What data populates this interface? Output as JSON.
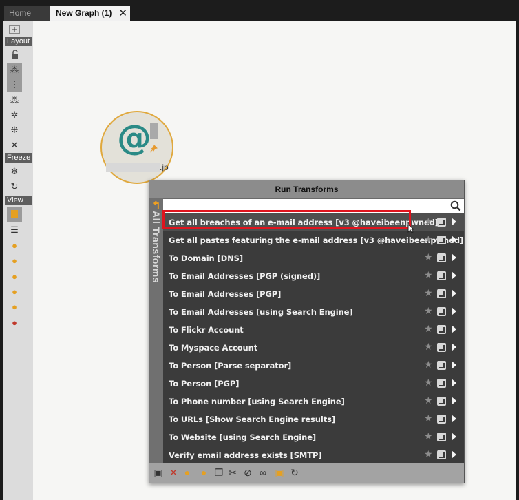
{
  "tabs": {
    "home": "Home",
    "active": "New Graph (1)",
    "close_glyph": "✕"
  },
  "toolbar": {
    "layout_label": "Layout",
    "freeze_label": "Freeze",
    "view_label": "View"
  },
  "entity": {
    "glyph": "@",
    "label_suffix": ".jp",
    "pin_icon": "pin-icon"
  },
  "panel": {
    "title": "Run Transforms",
    "side_label": "All Transforms",
    "search_value": "",
    "transforms": [
      "Get all breaches of an e-mail address [v3 @haveibeenpwned]",
      "Get all pastes featuring the e-mail address [v3 @haveibeenpwned]",
      "To Domain [DNS]",
      "To Email Addresses [PGP (signed)]",
      "To Email Addresses [PGP]",
      "To Email Addresses [using Search Engine]",
      "To Flickr Account",
      "To Myspace Account",
      "To Person [Parse separator]",
      "To Person [PGP]",
      "To Phone number [using Search Engine]",
      "To URLs [Show Search Engine results]",
      "To Website [using Search Engine]",
      "Verify email address exists [SMTP]"
    ]
  },
  "colors": {
    "accent_orange": "#e0a83c",
    "entity_teal": "#2a8a86",
    "highlight_red": "#e0141e"
  }
}
